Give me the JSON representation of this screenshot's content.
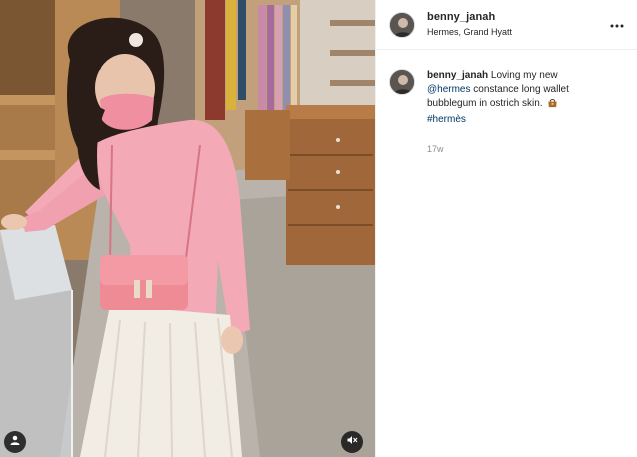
{
  "post": {
    "author": {
      "username": "benny_janah",
      "location": "Hermes, Grand Hyatt"
    },
    "caption": {
      "username": "benny_janah",
      "text_1": "Loving my new",
      "mention": "@hermes",
      "text_2": "constance long wallet bubblegum in ostrich skin.",
      "emoji_icon": "purse-emoji",
      "hashtag": "#hermès",
      "timestamp": "17w"
    },
    "media": {
      "type": "video",
      "controls": {
        "tag_icon": "user-tag-icon",
        "mute_icon": "speaker-muted-icon"
      }
    },
    "colors": {
      "link": "#00376b",
      "text": "#262626",
      "muted": "#8e8e8e",
      "sweater_pink": "#f3a9b6",
      "bag_pink": "#ef8b95"
    }
  }
}
